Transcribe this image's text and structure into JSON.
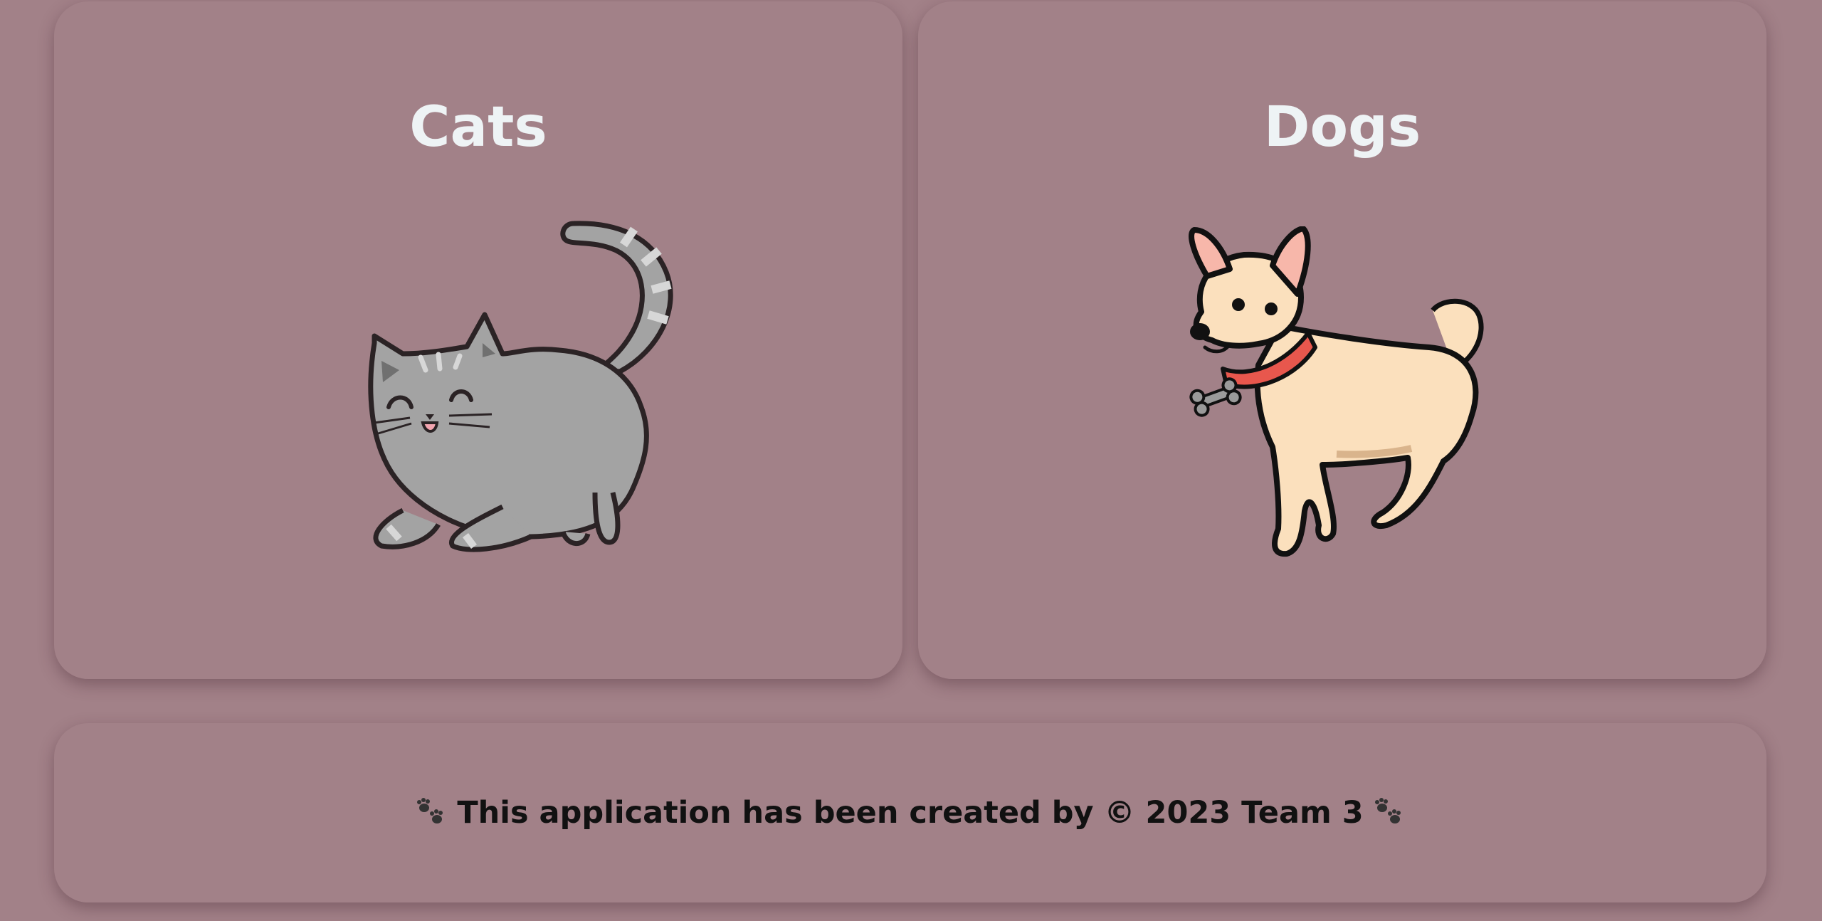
{
  "cards": [
    {
      "title": "Cats",
      "image": "cartoon gray cat"
    },
    {
      "title": "Dogs",
      "image": "cartoon chihuahua dog"
    }
  ],
  "footer": {
    "text": "This application has been created by © 2023 Team 3",
    "icon": "paw-prints-icon"
  },
  "colors": {
    "background": "#a28188",
    "title": "#eef3f5",
    "footer_text": "#111111"
  }
}
